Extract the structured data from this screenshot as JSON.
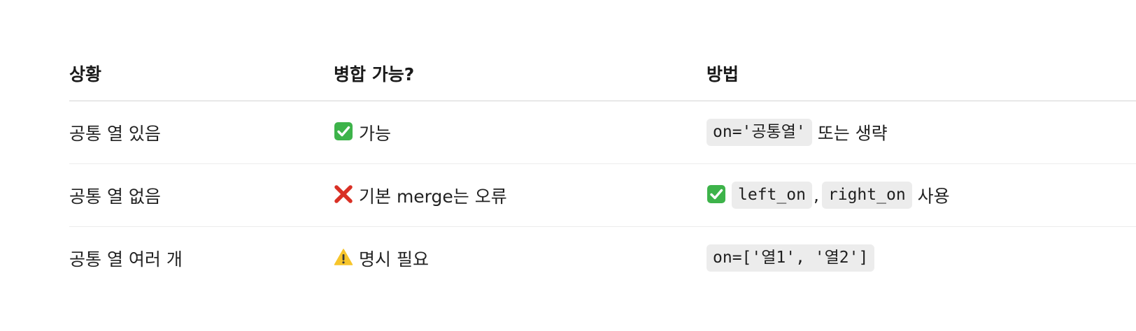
{
  "table": {
    "headers": [
      "상황",
      "병합 가능?",
      "방법"
    ],
    "rows": [
      {
        "situation": "공통 열 있음",
        "possible_icon": "check-mark-icon",
        "possible_text": "가능",
        "method_code1": "on='공통열'",
        "method_text": "또는 생략"
      },
      {
        "situation": "공통 열 없음",
        "possible_icon": "cross-mark-icon",
        "possible_text": "기본 merge는 오류",
        "method_icon": "check-mark-icon",
        "method_code1": "left_on",
        "method_sep": ",",
        "method_code2": "right_on",
        "method_text": "사용"
      },
      {
        "situation": "공통 열 여러 개",
        "possible_icon": "warning-icon",
        "possible_text": "명시 필요",
        "method_code1": "on=['열1', '열2']"
      }
    ]
  },
  "colors": {
    "check_green": "#3db34a",
    "cross_red": "#d93025",
    "warning_yellow": "#f7c52b",
    "code_bg": "#ececec"
  }
}
